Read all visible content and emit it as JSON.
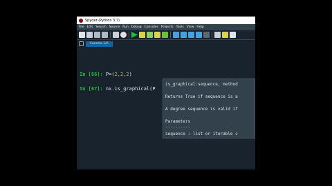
{
  "window": {
    "title": "Spyder (Python 3.7)"
  },
  "menu": [
    "File",
    "Edit",
    "Search",
    "Source",
    "Run",
    "Debug",
    "Consoles",
    "Projects",
    "Tools",
    "View",
    "Help"
  ],
  "toolbar_icons": [
    "new-file-icon",
    "open-file-icon",
    "save-icon",
    "save-all-icon",
    "open-icon",
    "email-icon",
    "run-icon",
    "run-cell-icon",
    "run-cell-advance-icon",
    "run-selection-icon",
    "debug-icon",
    "step-icon",
    "step-into-icon",
    "step-return-icon",
    "continue-icon",
    "stop-icon",
    "settings-icon",
    "python-path-icon",
    "expand-icon"
  ],
  "console": {
    "tab_label": "Console 1/A",
    "in66_prompt": "In [66]:",
    "in66_code_a": " P=(",
    "in66_nums": "2,2,2",
    "in66_code_b": ")",
    "in67_prompt": "In [67]:",
    "in67_code": " nx.is_graphical(P"
  },
  "calltip": {
    "sig_name": "is_graphical",
    "sig_paren": "(",
    "sig_rest": "sequence, method",
    "returns": "Returns True if sequence is a",
    "degree": "A degree sequence is valid if",
    "params": "Parameters",
    "dashes": "----------",
    "param1": "sequence : list or iterable c"
  },
  "colors": {
    "background": "#19232d",
    "prompt": "#1bc03a",
    "calltip_bg": "#32414b",
    "menubar": "#32414b"
  }
}
